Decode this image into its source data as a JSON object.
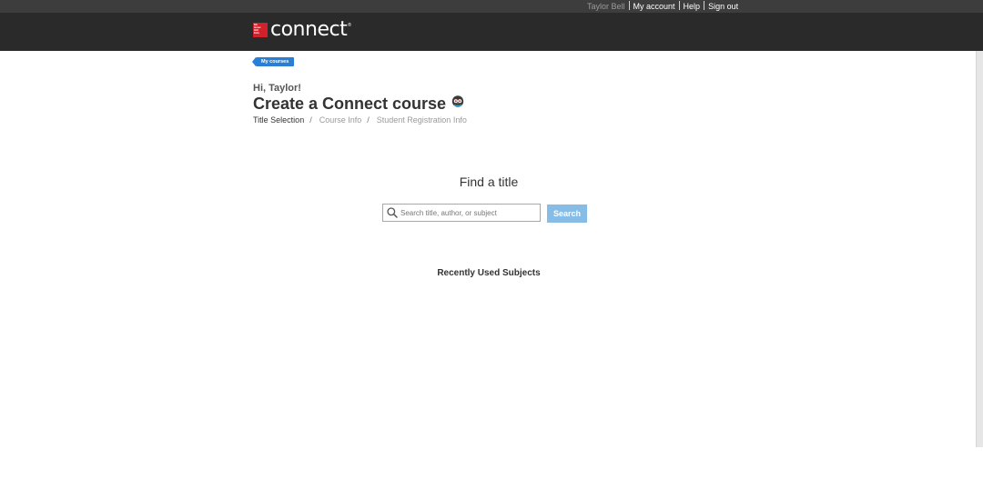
{
  "header": {
    "user_name": "Taylor Bell",
    "links": [
      "My account",
      "Help",
      "Sign out"
    ],
    "logo_text": "connect",
    "logo_badge": "Mc Graw Hill Education"
  },
  "nav": {
    "back_label": "My courses"
  },
  "page": {
    "greeting": "Hi, Taylor!",
    "title": "Create a Connect course",
    "mascot_icon": "owl-icon",
    "breadcrumb": [
      "Title Selection",
      "Course Info",
      "Student Registration Info"
    ]
  },
  "search": {
    "heading": "Find a title",
    "placeholder": "Search title, author, or subject",
    "value": "",
    "button_label": "Search",
    "button_color": "#86bce6"
  },
  "recent": {
    "heading": "Recently Used Subjects"
  },
  "colors": {
    "header_bg": "#2a2a2a",
    "topbar_bg": "#3d3d3d",
    "accent": "#2a7fd4",
    "logo_red": "#d4202a"
  }
}
